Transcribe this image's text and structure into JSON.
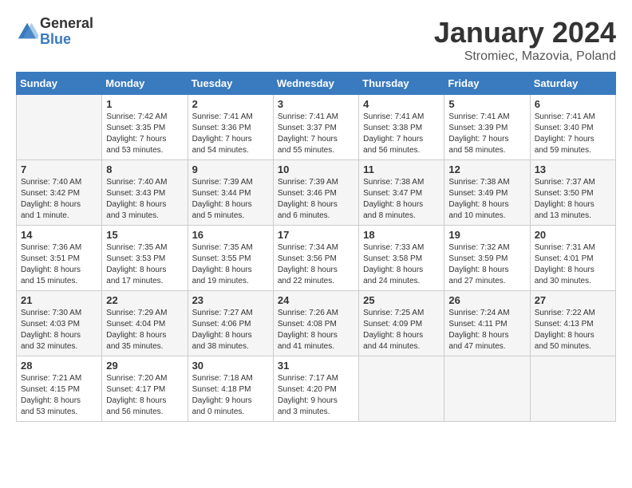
{
  "header": {
    "logo_general": "General",
    "logo_blue": "Blue",
    "month_title": "January 2024",
    "location": "Stromiec, Mazovia, Poland"
  },
  "calendar": {
    "days_of_week": [
      "Sunday",
      "Monday",
      "Tuesday",
      "Wednesday",
      "Thursday",
      "Friday",
      "Saturday"
    ],
    "weeks": [
      [
        {
          "day": "",
          "info": ""
        },
        {
          "day": "1",
          "info": "Sunrise: 7:42 AM\nSunset: 3:35 PM\nDaylight: 7 hours\nand 53 minutes."
        },
        {
          "day": "2",
          "info": "Sunrise: 7:41 AM\nSunset: 3:36 PM\nDaylight: 7 hours\nand 54 minutes."
        },
        {
          "day": "3",
          "info": "Sunrise: 7:41 AM\nSunset: 3:37 PM\nDaylight: 7 hours\nand 55 minutes."
        },
        {
          "day": "4",
          "info": "Sunrise: 7:41 AM\nSunset: 3:38 PM\nDaylight: 7 hours\nand 56 minutes."
        },
        {
          "day": "5",
          "info": "Sunrise: 7:41 AM\nSunset: 3:39 PM\nDaylight: 7 hours\nand 58 minutes."
        },
        {
          "day": "6",
          "info": "Sunrise: 7:41 AM\nSunset: 3:40 PM\nDaylight: 7 hours\nand 59 minutes."
        }
      ],
      [
        {
          "day": "7",
          "info": "Sunrise: 7:40 AM\nSunset: 3:42 PM\nDaylight: 8 hours\nand 1 minute."
        },
        {
          "day": "8",
          "info": "Sunrise: 7:40 AM\nSunset: 3:43 PM\nDaylight: 8 hours\nand 3 minutes."
        },
        {
          "day": "9",
          "info": "Sunrise: 7:39 AM\nSunset: 3:44 PM\nDaylight: 8 hours\nand 5 minutes."
        },
        {
          "day": "10",
          "info": "Sunrise: 7:39 AM\nSunset: 3:46 PM\nDaylight: 8 hours\nand 6 minutes."
        },
        {
          "day": "11",
          "info": "Sunrise: 7:38 AM\nSunset: 3:47 PM\nDaylight: 8 hours\nand 8 minutes."
        },
        {
          "day": "12",
          "info": "Sunrise: 7:38 AM\nSunset: 3:49 PM\nDaylight: 8 hours\nand 10 minutes."
        },
        {
          "day": "13",
          "info": "Sunrise: 7:37 AM\nSunset: 3:50 PM\nDaylight: 8 hours\nand 13 minutes."
        }
      ],
      [
        {
          "day": "14",
          "info": "Sunrise: 7:36 AM\nSunset: 3:51 PM\nDaylight: 8 hours\nand 15 minutes."
        },
        {
          "day": "15",
          "info": "Sunrise: 7:35 AM\nSunset: 3:53 PM\nDaylight: 8 hours\nand 17 minutes."
        },
        {
          "day": "16",
          "info": "Sunrise: 7:35 AM\nSunset: 3:55 PM\nDaylight: 8 hours\nand 19 minutes."
        },
        {
          "day": "17",
          "info": "Sunrise: 7:34 AM\nSunset: 3:56 PM\nDaylight: 8 hours\nand 22 minutes."
        },
        {
          "day": "18",
          "info": "Sunrise: 7:33 AM\nSunset: 3:58 PM\nDaylight: 8 hours\nand 24 minutes."
        },
        {
          "day": "19",
          "info": "Sunrise: 7:32 AM\nSunset: 3:59 PM\nDaylight: 8 hours\nand 27 minutes."
        },
        {
          "day": "20",
          "info": "Sunrise: 7:31 AM\nSunset: 4:01 PM\nDaylight: 8 hours\nand 30 minutes."
        }
      ],
      [
        {
          "day": "21",
          "info": "Sunrise: 7:30 AM\nSunset: 4:03 PM\nDaylight: 8 hours\nand 32 minutes."
        },
        {
          "day": "22",
          "info": "Sunrise: 7:29 AM\nSunset: 4:04 PM\nDaylight: 8 hours\nand 35 minutes."
        },
        {
          "day": "23",
          "info": "Sunrise: 7:27 AM\nSunset: 4:06 PM\nDaylight: 8 hours\nand 38 minutes."
        },
        {
          "day": "24",
          "info": "Sunrise: 7:26 AM\nSunset: 4:08 PM\nDaylight: 8 hours\nand 41 minutes."
        },
        {
          "day": "25",
          "info": "Sunrise: 7:25 AM\nSunset: 4:09 PM\nDaylight: 8 hours\nand 44 minutes."
        },
        {
          "day": "26",
          "info": "Sunrise: 7:24 AM\nSunset: 4:11 PM\nDaylight: 8 hours\nand 47 minutes."
        },
        {
          "day": "27",
          "info": "Sunrise: 7:22 AM\nSunset: 4:13 PM\nDaylight: 8 hours\nand 50 minutes."
        }
      ],
      [
        {
          "day": "28",
          "info": "Sunrise: 7:21 AM\nSunset: 4:15 PM\nDaylight: 8 hours\nand 53 minutes."
        },
        {
          "day": "29",
          "info": "Sunrise: 7:20 AM\nSunset: 4:17 PM\nDaylight: 8 hours\nand 56 minutes."
        },
        {
          "day": "30",
          "info": "Sunrise: 7:18 AM\nSunset: 4:18 PM\nDaylight: 9 hours\nand 0 minutes."
        },
        {
          "day": "31",
          "info": "Sunrise: 7:17 AM\nSunset: 4:20 PM\nDaylight: 9 hours\nand 3 minutes."
        },
        {
          "day": "",
          "info": ""
        },
        {
          "day": "",
          "info": ""
        },
        {
          "day": "",
          "info": ""
        }
      ]
    ]
  }
}
